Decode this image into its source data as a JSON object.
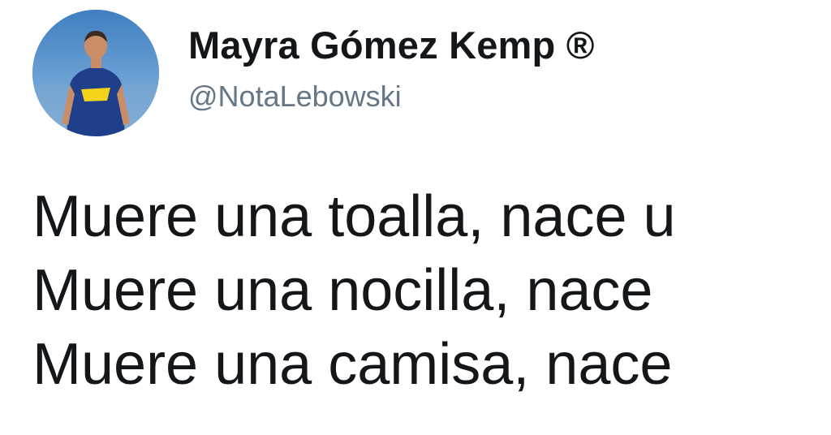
{
  "tweet": {
    "author": {
      "display_name": "Mayra Gómez Kemp ®",
      "handle": "@NotaLebowski",
      "avatar_icon": "profile-photo"
    },
    "lines": [
      "Muere una toalla, nace u",
      "Muere una nocilla, nace",
      "Muere una camisa, nace"
    ]
  },
  "colors": {
    "text": "#14171a",
    "handle": "#657786",
    "background": "#ffffff"
  }
}
